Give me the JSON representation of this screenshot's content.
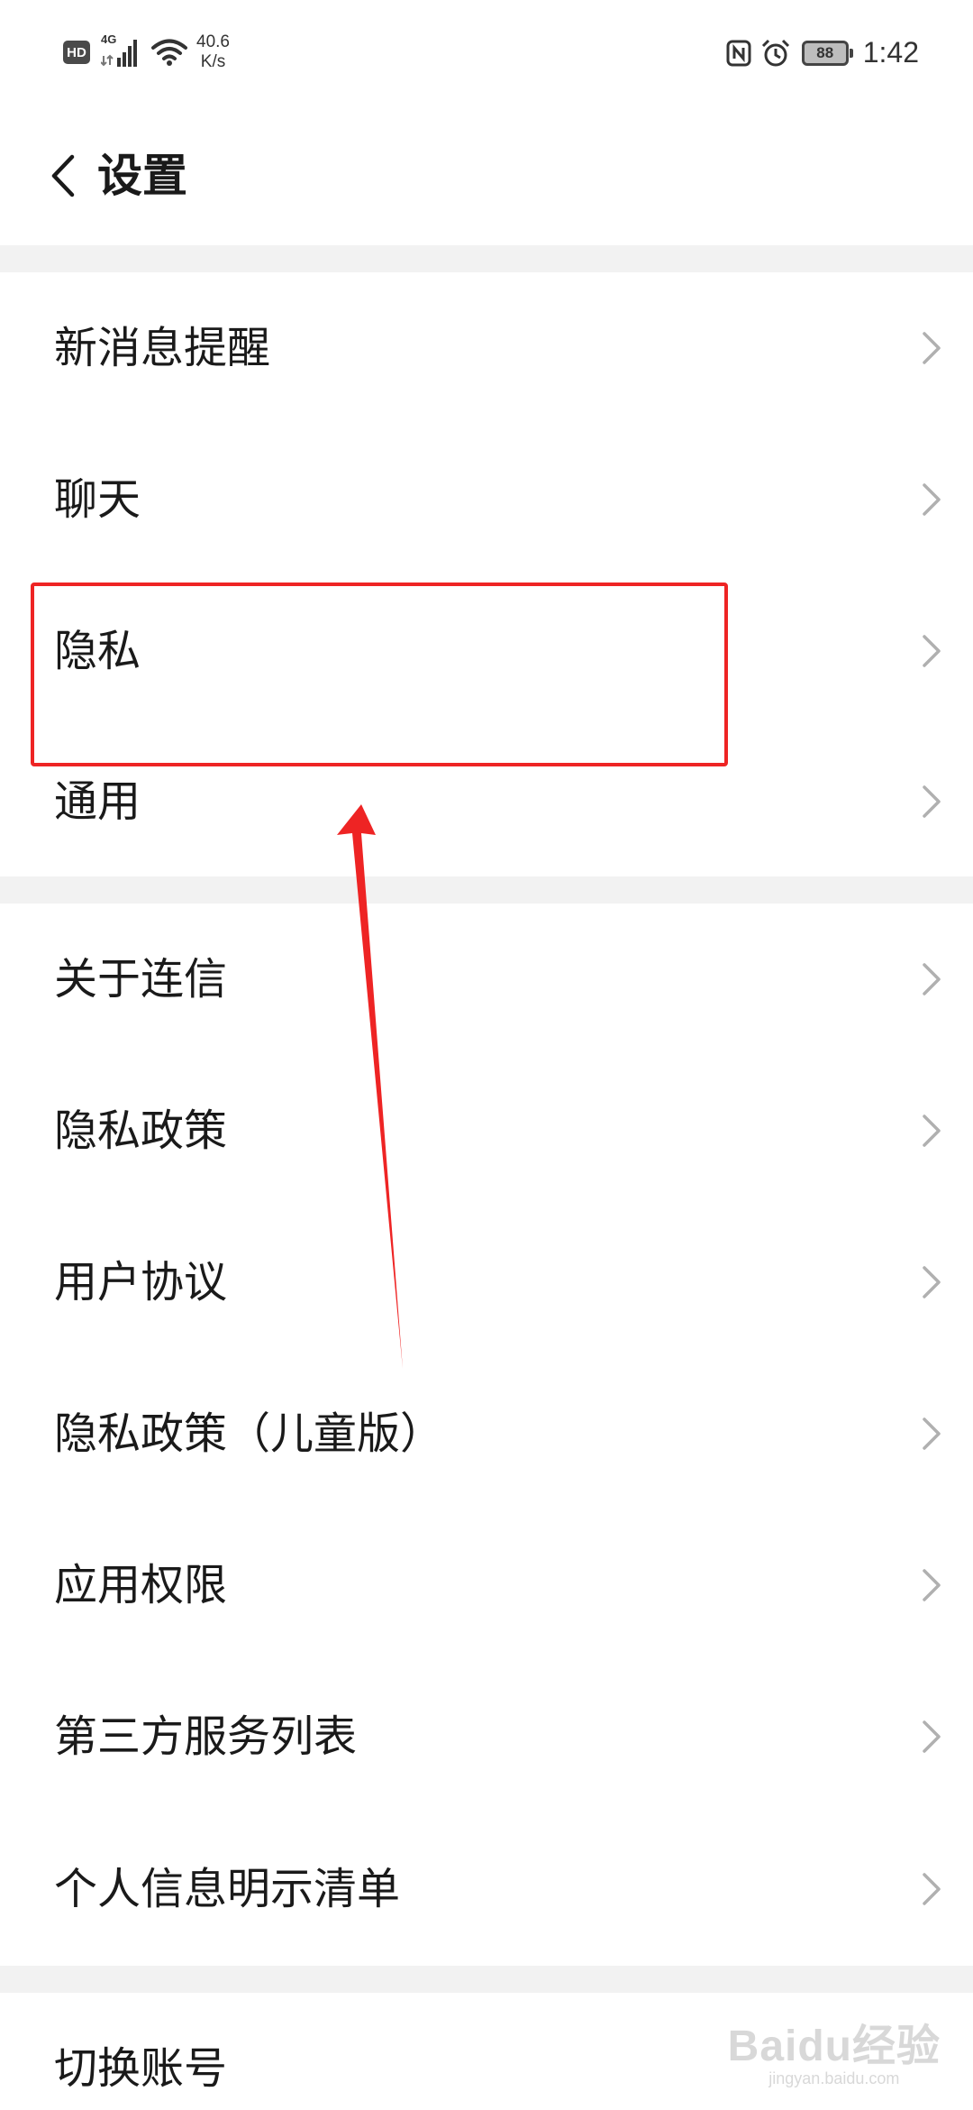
{
  "status_bar": {
    "hd_label": "HD",
    "network_label": "4G",
    "speed_value": "40.6",
    "speed_unit": "K/s",
    "battery_level": "88",
    "time": "1:42",
    "icons": [
      "hd-icon",
      "signal-icon",
      "wifi-icon",
      "nfc-icon",
      "alarm-icon",
      "battery-icon"
    ]
  },
  "header": {
    "title": "设置"
  },
  "settings": {
    "group1": [
      {
        "label": "新消息提醒"
      },
      {
        "label": "聊天"
      },
      {
        "label": "隐私"
      },
      {
        "label": "通用"
      }
    ],
    "group2": [
      {
        "label": "关于连信"
      },
      {
        "label": "隐私政策"
      },
      {
        "label": "用户协议"
      },
      {
        "label": "隐私政策（儿童版）"
      },
      {
        "label": "应用权限"
      },
      {
        "label": "第三方服务列表"
      },
      {
        "label": "个人信息明示清单"
      }
    ],
    "group3": [
      {
        "label": "切换账号"
      }
    ]
  },
  "annotation": {
    "highlight_color": "#ee2424",
    "highlighted_item": "隐私"
  },
  "watermark": {
    "main": "Baidu经验",
    "sub": "jingyan.baidu.com"
  },
  "colors": {
    "background": "#ffffff",
    "divider": "#f2f2f2",
    "text": "#1a1a1a",
    "chevron": "#b0b0b0",
    "annotation": "#ee2424"
  }
}
